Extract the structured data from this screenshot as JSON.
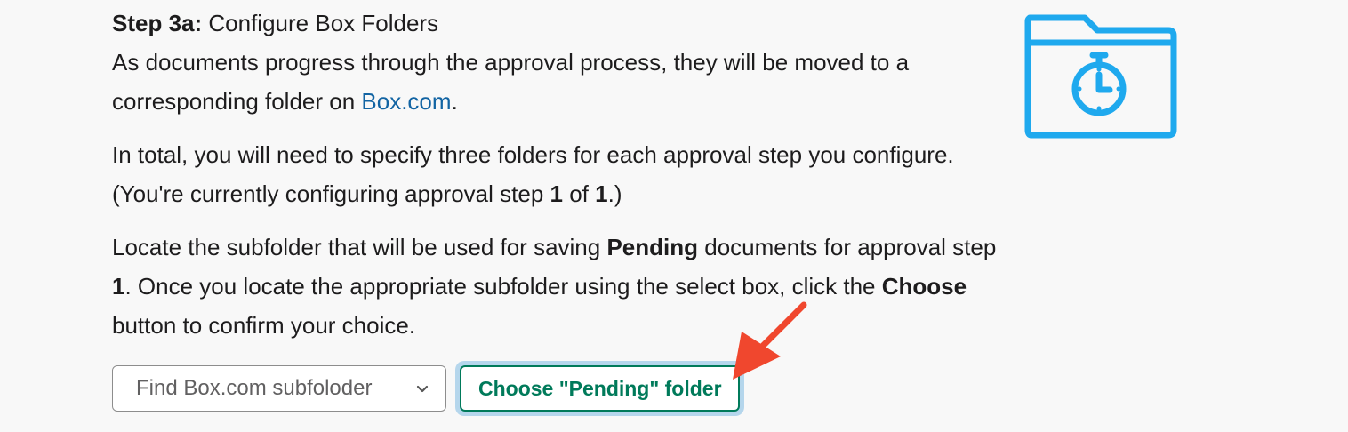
{
  "heading": {
    "step_label": "Step 3a:",
    "title": "Configure Box Folders"
  },
  "para1": {
    "text_before_link": "As documents progress through the approval process, they will be moved to a corresponding folder on ",
    "link_text": "Box.com",
    "text_after_link": "."
  },
  "para2": {
    "text_1": "In total, you will need to specify three folders for each approval step you configure. (You're currently configuring approval step ",
    "current_step": "1",
    "text_2": " of ",
    "total_steps": "1",
    "text_3": ".)"
  },
  "para3": {
    "text_1": "Locate the subfolder that will be used for saving ",
    "folder_kind": "Pending",
    "text_2": " documents for approval step ",
    "step": "1",
    "text_3": ". Once you locate the appropriate subfolder using the select box, click the ",
    "button_ref": "Choose",
    "text_4": " button to confirm your choice."
  },
  "select": {
    "selected_value": "Find Box.com subfoloder",
    "icon": "chevron-down-icon"
  },
  "choose_button": {
    "label": "Choose \"Pending\" folder"
  },
  "illustration": {
    "icon": "folder-stopwatch-icon"
  },
  "annotation": {
    "icon": "arrow-pointer-icon"
  },
  "colors": {
    "link": "#1264a3",
    "button_text": "#007a5a",
    "button_focus_ring": "#b5d6ec",
    "illustration": "#1fa9ee",
    "arrow": "#f0472e"
  }
}
